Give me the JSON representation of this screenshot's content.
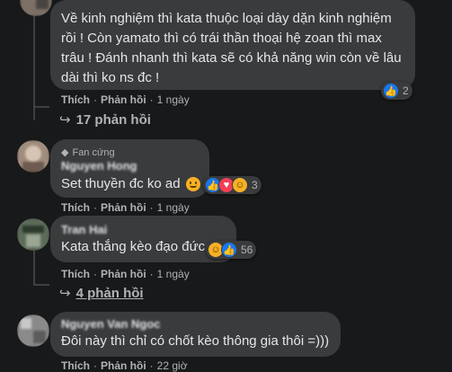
{
  "comments": [
    {
      "text_lines": [
        "Về kinh nghiệm thì kata thuộc loại dày dặn kinh nghiệm",
        "rồi ! Còn yamato thì có trái thần thoại hệ zoan thì max",
        "trâu ! Đánh nhanh thì kata sẽ có khả năng win còn về lâu",
        "dài thì ko ns đc !"
      ],
      "actions": {
        "like": "Thích",
        "reply": "Phản hồi",
        "sep": "·",
        "time": "1 ngày"
      },
      "reactions": {
        "count": "2",
        "icons": [
          "like-icon"
        ]
      },
      "replies_label": "17 phản hồi"
    },
    {
      "badge": "Fan cứng",
      "author": "Nguyen Hong",
      "text": "Set thuyền đc ko ad",
      "actions": {
        "like": "Thích",
        "reply": "Phản hồi",
        "sep": "·",
        "time": "1 ngày"
      },
      "reactions": {
        "count": "3",
        "icons": [
          "like-icon",
          "love-icon",
          "haha-icon"
        ]
      }
    },
    {
      "author": "Tran Hai",
      "text": "Kata thắng kèo đạo đức",
      "actions": {
        "like": "Thích",
        "reply": "Phản hồi",
        "sep": "·",
        "time": "1 ngày"
      },
      "reactions": {
        "count": "56",
        "icons": [
          "haha-icon",
          "like-icon"
        ]
      },
      "replies_label": "4 phản hồi"
    },
    {
      "author": "Nguyen Van Ngoc",
      "text": "Đôi này thì chỉ có chốt kèo thông gia thôi =)))",
      "actions": {
        "like": "Thích",
        "reply": "Phản hồi",
        "sep": "·",
        "time": "22 giờ"
      }
    }
  ],
  "colors": {
    "background": "#18191a",
    "bubble": "#3a3b3c",
    "text": "#e4e6eb",
    "secondary": "#b0b3b8",
    "like_blue": "#1877f2",
    "love_red": "#f33e58",
    "haha_yellow": "#f7b125"
  }
}
